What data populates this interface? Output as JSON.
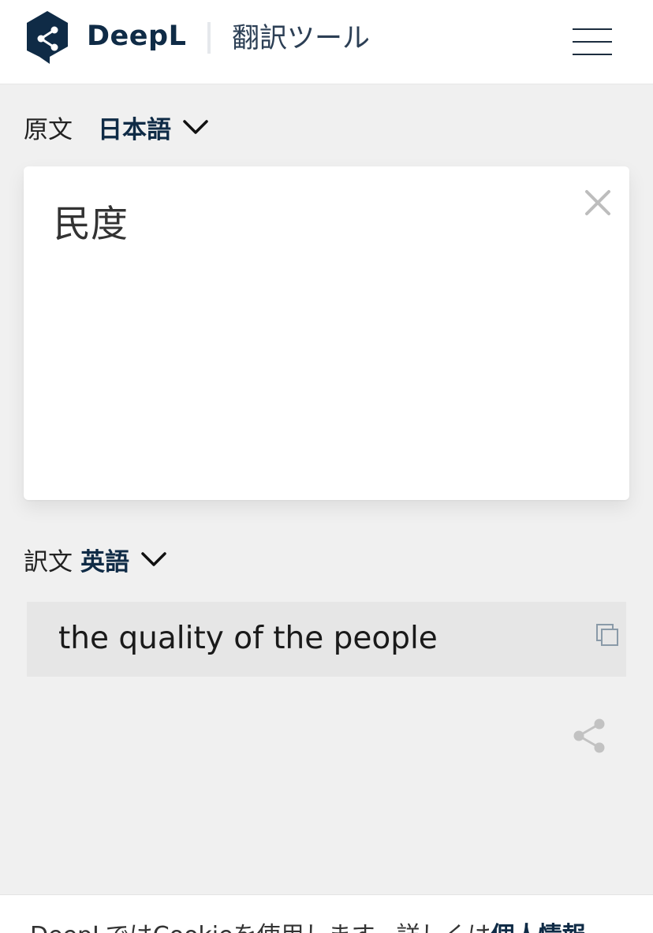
{
  "header": {
    "brand": "DeepL",
    "tool_title": "翻訳ツール",
    "logo_color": "#0f2b46"
  },
  "source": {
    "label": "原文",
    "language": "日本語",
    "text": "民度"
  },
  "target": {
    "label": "訳文",
    "language": "英語",
    "text": "the quality of the people"
  },
  "icons": {
    "menu": "hamburger-icon",
    "clear": "close-icon",
    "copy": "copy-icon",
    "share": "share-icon",
    "dropdown": "chevron-down-icon"
  },
  "cookie": {
    "text": "DeepLではCookieを使用します。詳しくは",
    "link": "個人情報"
  }
}
